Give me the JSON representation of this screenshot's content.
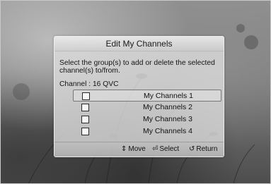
{
  "dialog": {
    "title": "Edit My Channels",
    "prompt": "Select the group(s) to add or delete the selected channel(s) to/from.",
    "channel_line": "Channel : 16 QVC"
  },
  "groups": [
    {
      "label": "My Channels 1",
      "checked": false,
      "focused": true
    },
    {
      "label": "My Channels 2",
      "checked": false,
      "focused": false
    },
    {
      "label": "My Channels 3",
      "checked": false,
      "focused": false
    },
    {
      "label": "My Channels 4",
      "checked": false,
      "focused": false
    }
  ],
  "footer": {
    "move_icon": "up-down-arrows-icon",
    "move_glyph": "⇕",
    "move_label": "Move",
    "select_icon": "enter-icon",
    "select_glyph": "⏎",
    "select_label": "Select",
    "return_icon": "return-arrow-icon",
    "return_glyph": "↺",
    "return_label": "Return"
  }
}
